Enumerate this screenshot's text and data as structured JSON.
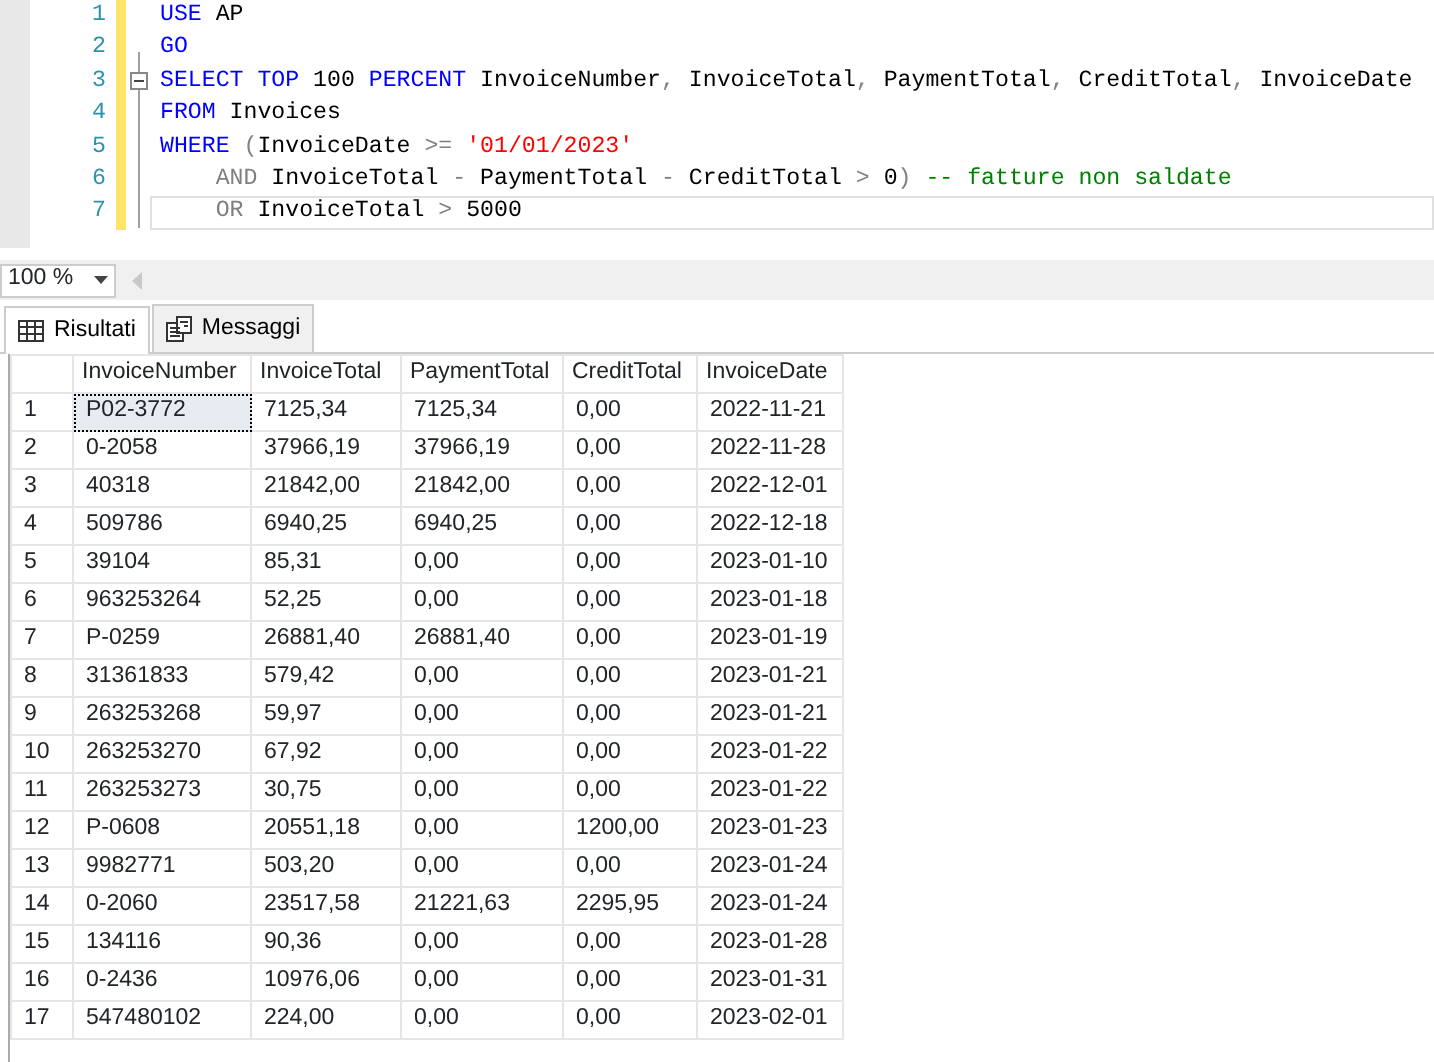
{
  "editor": {
    "lines": [
      {
        "number": "1",
        "kind": "plain",
        "current": false,
        "tokens": [
          {
            "kind": "keyword",
            "text": "USE"
          },
          {
            "kind": "ident",
            "text": " AP"
          }
        ]
      },
      {
        "number": "2",
        "kind": "plain",
        "current": false,
        "tokens": [
          {
            "kind": "keyword",
            "text": "GO"
          }
        ]
      },
      {
        "number": "3",
        "kind": "block",
        "current": false,
        "tokens": [
          {
            "kind": "keyword",
            "text": "SELECT TOP"
          },
          {
            "kind": "ident",
            "text": " 100 "
          },
          {
            "kind": "keyword",
            "text": "PERCENT"
          },
          {
            "kind": "ident",
            "text": " InvoiceNumber"
          },
          {
            "kind": "operator",
            "text": ","
          },
          {
            "kind": "ident",
            "text": " InvoiceTotal"
          },
          {
            "kind": "operator",
            "text": ","
          },
          {
            "kind": "ident",
            "text": " PaymentTotal"
          },
          {
            "kind": "operator",
            "text": ","
          },
          {
            "kind": "ident",
            "text": " CreditTotal"
          },
          {
            "kind": "operator",
            "text": ","
          },
          {
            "kind": "ident",
            "text": " InvoiceDate"
          }
        ]
      },
      {
        "number": "4",
        "kind": "plain",
        "current": false,
        "tokens": [
          {
            "kind": "keyword",
            "text": "FROM"
          },
          {
            "kind": "ident",
            "text": " Invoices"
          }
        ]
      },
      {
        "number": "5",
        "kind": "plain",
        "current": false,
        "tokens": [
          {
            "kind": "keyword",
            "text": "WHERE"
          },
          {
            "kind": "operator",
            "text": " ("
          },
          {
            "kind": "ident",
            "text": "InvoiceDate "
          },
          {
            "kind": "operator",
            "text": ">= "
          },
          {
            "kind": "string",
            "text": "'01/01/2023'"
          }
        ]
      },
      {
        "number": "6",
        "kind": "plain",
        "current": false,
        "tokens": [
          {
            "kind": "operator",
            "text": "    AND"
          },
          {
            "kind": "ident",
            "text": " InvoiceTotal "
          },
          {
            "kind": "operator",
            "text": "-"
          },
          {
            "kind": "ident",
            "text": " PaymentTotal "
          },
          {
            "kind": "operator",
            "text": "-"
          },
          {
            "kind": "ident",
            "text": " CreditTotal "
          },
          {
            "kind": "operator",
            "text": ">"
          },
          {
            "kind": "ident",
            "text": " 0"
          },
          {
            "kind": "operator",
            "text": ") "
          },
          {
            "kind": "comment",
            "text": "-- fatture non saldate"
          }
        ]
      },
      {
        "number": "7",
        "kind": "plain",
        "current": true,
        "tokens": [
          {
            "kind": "operator",
            "text": "    OR"
          },
          {
            "kind": "ident",
            "text": " InvoiceTotal "
          },
          {
            "kind": "operator",
            "text": ">"
          },
          {
            "kind": "ident",
            "text": " 5000"
          }
        ]
      }
    ]
  },
  "zoom": {
    "value": "100 %"
  },
  "tabs": [
    {
      "label": "Risultati",
      "kind": "grid",
      "selected": true
    },
    {
      "label": "Messaggi",
      "kind": "messages",
      "selected": false
    }
  ],
  "table": {
    "columns": [
      "InvoiceNumber",
      "InvoiceTotal",
      "PaymentTotal",
      "CreditTotal",
      "InvoiceDate"
    ],
    "rows": [
      {
        "number": "1",
        "selected": true,
        "cells": [
          "P02-3772",
          "7125,34",
          "7125,34",
          "0,00",
          "2022-11-21"
        ]
      },
      {
        "number": "2",
        "selected": false,
        "cells": [
          "0-2058",
          "37966,19",
          "37966,19",
          "0,00",
          "2022-11-28"
        ]
      },
      {
        "number": "3",
        "selected": false,
        "cells": [
          "40318",
          "21842,00",
          "21842,00",
          "0,00",
          "2022-12-01"
        ]
      },
      {
        "number": "4",
        "selected": false,
        "cells": [
          "509786",
          "6940,25",
          "6940,25",
          "0,00",
          "2022-12-18"
        ]
      },
      {
        "number": "5",
        "selected": false,
        "cells": [
          "39104",
          "85,31",
          "0,00",
          "0,00",
          "2023-01-10"
        ]
      },
      {
        "number": "6",
        "selected": false,
        "cells": [
          "963253264",
          "52,25",
          "0,00",
          "0,00",
          "2023-01-18"
        ]
      },
      {
        "number": "7",
        "selected": false,
        "cells": [
          "P-0259",
          "26881,40",
          "26881,40",
          "0,00",
          "2023-01-19"
        ]
      },
      {
        "number": "8",
        "selected": false,
        "cells": [
          "31361833",
          "579,42",
          "0,00",
          "0,00",
          "2023-01-21"
        ]
      },
      {
        "number": "9",
        "selected": false,
        "cells": [
          "263253268",
          "59,97",
          "0,00",
          "0,00",
          "2023-01-21"
        ]
      },
      {
        "number": "10",
        "selected": false,
        "cells": [
          "263253270",
          "67,92",
          "0,00",
          "0,00",
          "2023-01-22"
        ]
      },
      {
        "number": "11",
        "selected": false,
        "cells": [
          "263253273",
          "30,75",
          "0,00",
          "0,00",
          "2023-01-22"
        ]
      },
      {
        "number": "12",
        "selected": false,
        "cells": [
          "P-0608",
          "20551,18",
          "0,00",
          "1200,00",
          "2023-01-23"
        ]
      },
      {
        "number": "13",
        "selected": false,
        "cells": [
          "9982771",
          "503,20",
          "0,00",
          "0,00",
          "2023-01-24"
        ]
      },
      {
        "number": "14",
        "selected": false,
        "cells": [
          "0-2060",
          "23517,58",
          "21221,63",
          "2295,95",
          "2023-01-24"
        ]
      },
      {
        "number": "15",
        "selected": false,
        "cells": [
          "134116",
          "90,36",
          "0,00",
          "0,00",
          "2023-01-28"
        ]
      },
      {
        "number": "16",
        "selected": false,
        "cells": [
          "0-2436",
          "10976,06",
          "0,00",
          "0,00",
          "2023-01-31"
        ]
      },
      {
        "number": "17",
        "selected": false,
        "cells": [
          "547480102",
          "224,00",
          "0,00",
          "0,00",
          "2023-02-01"
        ]
      }
    ]
  }
}
